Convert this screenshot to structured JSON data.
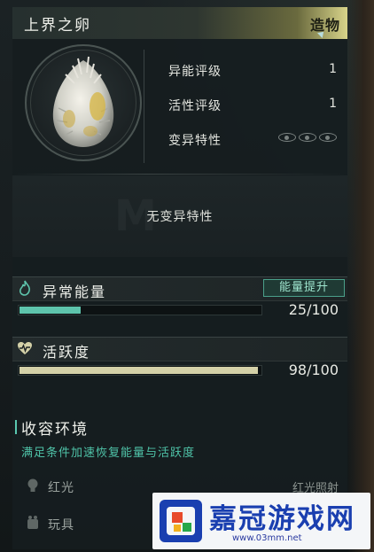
{
  "item": {
    "name": "上界之卵",
    "type": "造物",
    "icon": "egg-icon"
  },
  "stats": [
    {
      "label": "异能评级",
      "value": "1"
    },
    {
      "label": "活性评级",
      "value": "1"
    },
    {
      "label": "变异特性",
      "value": ""
    }
  ],
  "traits_text": "无变异特性",
  "energy": {
    "label": "异常能量",
    "icon": "flame-icon",
    "button_label": "能量提升",
    "value_text": "25/100",
    "fraction": 0.25,
    "color": "#5ec4ac"
  },
  "activity": {
    "label": "活跃度",
    "icon": "heartbeat-icon",
    "value_text": "98/100",
    "fraction": 0.98,
    "color": "#d4d1a8"
  },
  "environment": {
    "title": "收容环境",
    "subtitle": "满足条件加速恢复能量与活跃度",
    "rows": [
      {
        "label": "红光",
        "value": "红光照射",
        "icon": "bulb-icon"
      },
      {
        "label": "玩具",
        "value": "",
        "icon": "toy-icon"
      }
    ]
  },
  "watermark": {
    "text": "嘉冠游戏网",
    "url": "www.03mm.net"
  },
  "colors": {
    "accent_teal": "#4fc3a8",
    "title_gold": "#d8d48a",
    "panel_bg": "#161c1e"
  }
}
